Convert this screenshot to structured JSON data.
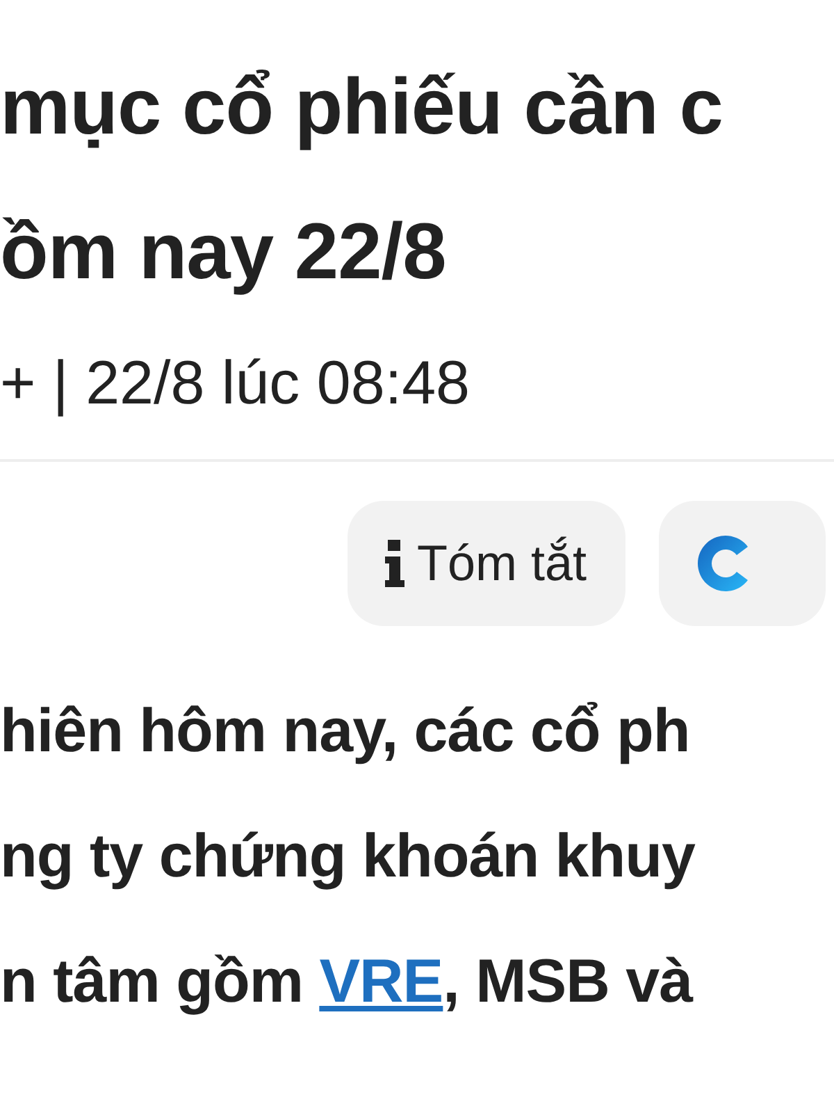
{
  "article": {
    "title_lines": [
      "mục cổ phiếu cần c",
      "ồm nay 22/8"
    ],
    "meta": "+ | 22/8 lúc 08:48",
    "actions": [
      {
        "kind": "info",
        "label": "Tóm tắt"
      },
      {
        "kind": "logo"
      }
    ],
    "body_lines": [
      [
        {
          "kind": "text",
          "text": "hiên hôm nay, các cổ ph"
        }
      ],
      [
        {
          "kind": "text",
          "text": "ng ty chứng khoán khuy"
        }
      ],
      [
        {
          "kind": "text",
          "text": "n tâm gồm "
        },
        {
          "kind": "link",
          "text": "VRE"
        },
        {
          "kind": "text",
          "text": ", MSB và"
        }
      ]
    ]
  }
}
